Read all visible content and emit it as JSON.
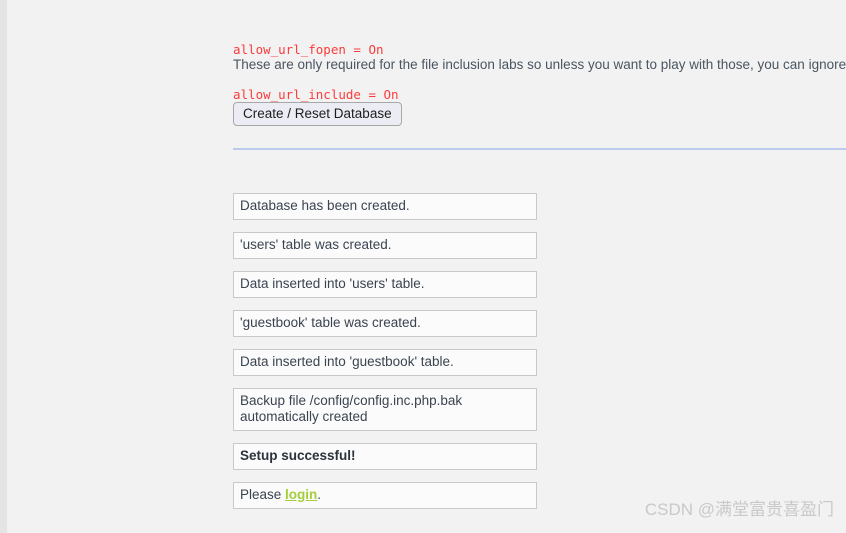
{
  "page": {
    "background_color": "#f2f2f2",
    "divider_color": "#bccaee"
  },
  "php_config": {
    "color": "#fb3b3b",
    "lines": [
      "allow_url_fopen = On",
      "allow_url_include = On"
    ]
  },
  "setup_note": {
    "text": "These are only required for the file inclusion labs so unless you want to play with those, you can ignore them."
  },
  "buttons": {
    "create_reset_database": "Create / Reset Database"
  },
  "messages": {
    "items": [
      {
        "text": "Database has been created.",
        "bold": false
      },
      {
        "text": "'users' table was created.",
        "bold": false
      },
      {
        "text": "Data inserted into 'users' table.",
        "bold": false
      },
      {
        "text": "'guestbook' table was created.",
        "bold": false
      },
      {
        "text": "Data inserted into 'guestbook' table.",
        "bold": false
      },
      {
        "text": "Backup file /config/config.inc.php.bak automatically created",
        "bold": false
      },
      {
        "text": "Setup successful!",
        "bold": true
      }
    ],
    "login_prompt": {
      "prefix": "Please ",
      "link_label": "login",
      "suffix": ".",
      "link_color": "#a4ce3a"
    }
  },
  "watermark": {
    "text": "CSDN @满堂富贵喜盈门"
  }
}
